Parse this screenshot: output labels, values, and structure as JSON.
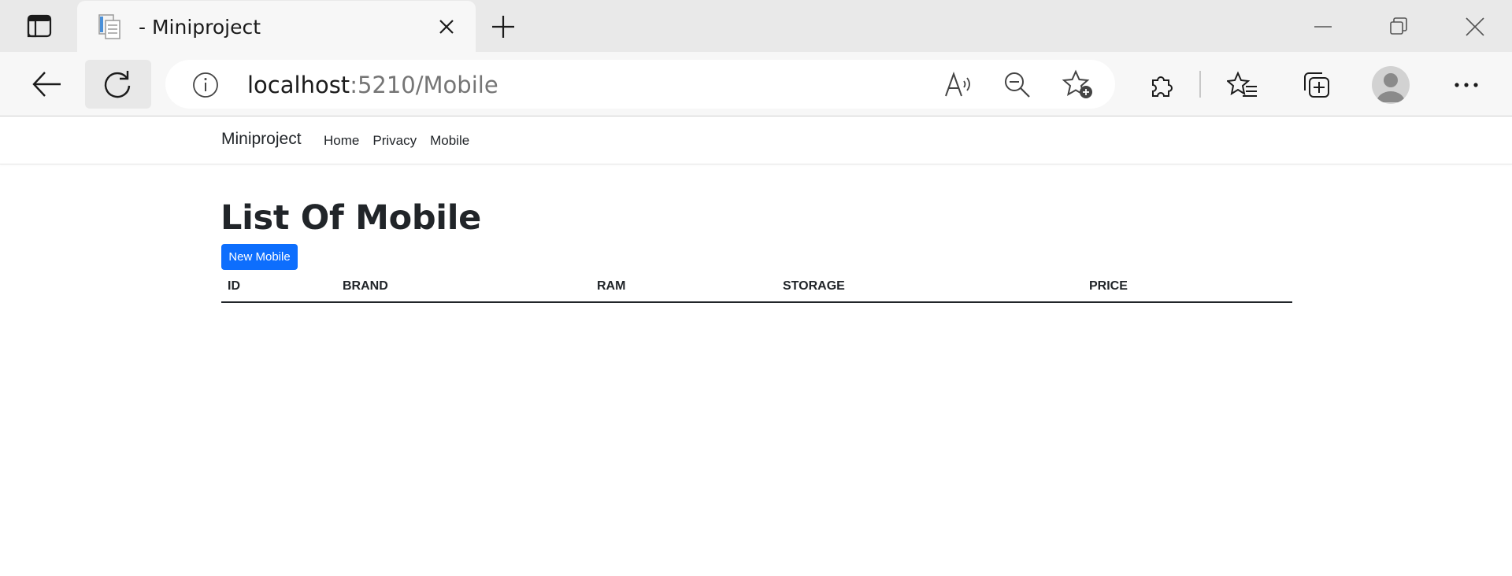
{
  "browser": {
    "tab": {
      "title": "- Miniproject"
    },
    "address": {
      "host": "localhost",
      "path": ":5210/Mobile"
    }
  },
  "navbar": {
    "brand": "Miniproject",
    "links": [
      {
        "label": "Home"
      },
      {
        "label": "Privacy"
      },
      {
        "label": "Mobile"
      }
    ]
  },
  "page": {
    "title": "List Of Mobile",
    "new_button": "New Mobile",
    "accent": "#0d6efd"
  },
  "table": {
    "columns": [
      "ID",
      "BRAND",
      "RAM",
      "STORAGE",
      "PRICE"
    ],
    "rows": []
  }
}
